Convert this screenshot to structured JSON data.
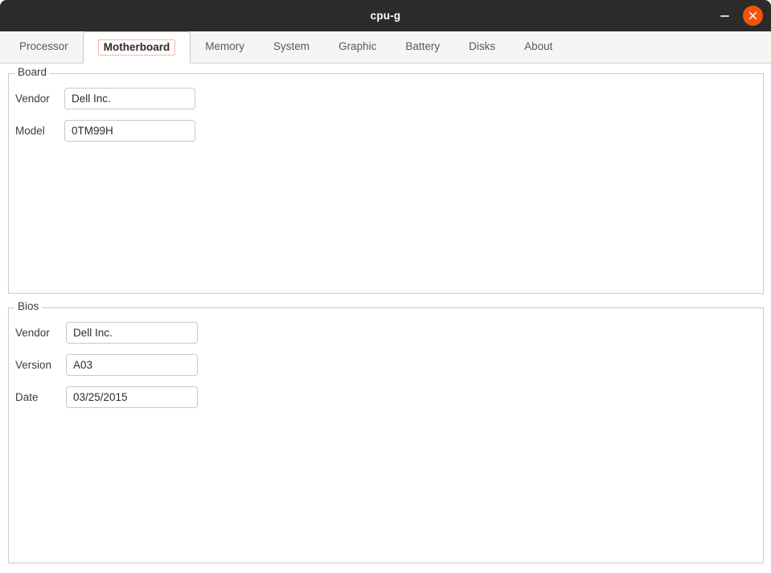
{
  "window": {
    "title": "cpu-g",
    "controls": {
      "minimize_label": "–",
      "minimize_name": "minimize-icon",
      "close_label": "✕",
      "close_name": "close-icon",
      "close_color": "#f2540b"
    }
  },
  "tabs": [
    {
      "label": "Processor",
      "active": false
    },
    {
      "label": "Motherboard",
      "active": true
    },
    {
      "label": "Memory",
      "active": false
    },
    {
      "label": "System",
      "active": false
    },
    {
      "label": "Graphic",
      "active": false
    },
    {
      "label": "Battery",
      "active": false
    },
    {
      "label": "Disks",
      "active": false
    },
    {
      "label": "About",
      "active": false
    }
  ],
  "board": {
    "title": "Board",
    "vendor_label": "Vendor",
    "vendor_value": "Dell Inc.",
    "model_label": "Model",
    "model_value": "0TM99H"
  },
  "bios": {
    "title": "Bios",
    "vendor_label": "Vendor",
    "vendor_value": "Dell Inc.",
    "version_label": "Version",
    "version_value": "A03",
    "date_label": "Date",
    "date_value": "03/25/2015"
  }
}
